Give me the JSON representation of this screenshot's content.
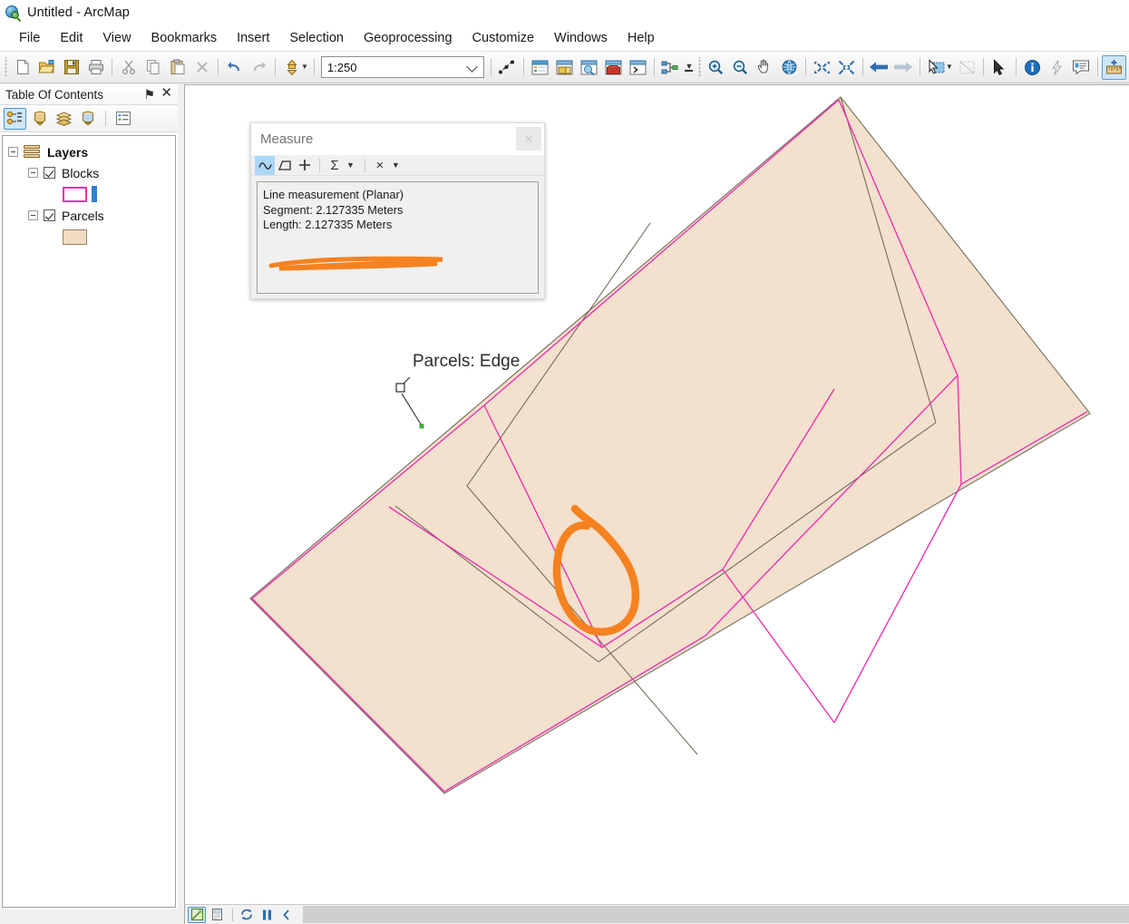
{
  "window": {
    "title": "Untitled - ArcMap",
    "app_icon": "arcmap-globe-icon"
  },
  "menubar": {
    "items": [
      {
        "label": "File",
        "name": "menu-file"
      },
      {
        "label": "Edit",
        "name": "menu-edit"
      },
      {
        "label": "View",
        "name": "menu-view"
      },
      {
        "label": "Bookmarks",
        "name": "menu-bookmarks"
      },
      {
        "label": "Insert",
        "name": "menu-insert"
      },
      {
        "label": "Selection",
        "name": "menu-selection"
      },
      {
        "label": "Geoprocessing",
        "name": "menu-geoprocessing"
      },
      {
        "label": "Customize",
        "name": "menu-customize"
      },
      {
        "label": "Windows",
        "name": "menu-windows"
      },
      {
        "label": "Help",
        "name": "menu-help"
      }
    ]
  },
  "toolbar": {
    "scale_value": "1:250",
    "scale_placeholder": "1:250",
    "buttons": [
      {
        "name": "new-document-icon",
        "tooltip": "New"
      },
      {
        "name": "open-document-icon",
        "tooltip": "Open"
      },
      {
        "name": "save-icon",
        "tooltip": "Save"
      },
      {
        "name": "print-icon",
        "tooltip": "Print"
      },
      {
        "name": "cut-icon",
        "tooltip": "Cut"
      },
      {
        "name": "copy-icon",
        "tooltip": "Copy"
      },
      {
        "name": "paste-icon",
        "tooltip": "Paste"
      },
      {
        "name": "delete-icon",
        "tooltip": "Delete"
      },
      {
        "name": "undo-icon",
        "tooltip": "Undo"
      },
      {
        "name": "redo-icon",
        "tooltip": "Redo"
      },
      {
        "name": "add-data-icon",
        "tooltip": "Add Data"
      },
      {
        "name": "editor-toolbar-icon",
        "tooltip": "Editor"
      },
      {
        "name": "table-of-contents-icon",
        "tooltip": "Table Of Contents"
      },
      {
        "name": "catalog-icon",
        "tooltip": "Catalog"
      },
      {
        "name": "search-window-icon",
        "tooltip": "Search"
      },
      {
        "name": "arctoolbox-icon",
        "tooltip": "ArcToolbox"
      },
      {
        "name": "python-window-icon",
        "tooltip": "Python"
      },
      {
        "name": "model-builder-icon",
        "tooltip": "ModelBuilder"
      },
      {
        "name": "zoom-in-icon",
        "tooltip": "Zoom In"
      },
      {
        "name": "zoom-out-icon",
        "tooltip": "Zoom Out"
      },
      {
        "name": "pan-icon",
        "tooltip": "Pan"
      },
      {
        "name": "full-extent-icon",
        "tooltip": "Full Extent"
      },
      {
        "name": "fixed-zoom-in-icon",
        "tooltip": "Fixed Zoom In"
      },
      {
        "name": "fixed-zoom-out-icon",
        "tooltip": "Fixed Zoom Out"
      },
      {
        "name": "go-back-extent-icon",
        "tooltip": "Go Back To Previous Extent"
      },
      {
        "name": "go-next-extent-icon",
        "tooltip": "Go To Next Extent"
      },
      {
        "name": "select-features-icon",
        "tooltip": "Select Features"
      },
      {
        "name": "clear-selection-icon",
        "tooltip": "Clear Selected Features"
      },
      {
        "name": "select-elements-icon",
        "tooltip": "Select Elements"
      },
      {
        "name": "identify-icon",
        "tooltip": "Identify"
      },
      {
        "name": "hyperlink-icon",
        "tooltip": "Hyperlink"
      },
      {
        "name": "html-popup-icon",
        "tooltip": "HTML Popup"
      },
      {
        "name": "measure-icon",
        "tooltip": "Measure"
      }
    ]
  },
  "toc": {
    "title": "Table Of Contents",
    "pin_glyph": "⚑",
    "close_glyph": "✕",
    "tool_buttons": [
      {
        "name": "list-by-drawing-order-icon",
        "active": true
      },
      {
        "name": "list-by-source-icon",
        "active": false
      },
      {
        "name": "list-by-visibility-icon",
        "active": false
      },
      {
        "name": "list-by-selection-icon",
        "active": false
      },
      {
        "name": "options-icon",
        "active": false
      }
    ],
    "tree": {
      "root_label": "Layers",
      "layers": [
        {
          "label": "Blocks",
          "checked": true,
          "symbol": "hollow-magenta-rectangle-plus-blue-bar"
        },
        {
          "label": "Parcels",
          "checked": true,
          "symbol": "tan-filled-rectangle"
        }
      ]
    }
  },
  "measure_dialog": {
    "title": "Measure",
    "close_glyph": "×",
    "tools": [
      {
        "name": "measure-line-tool",
        "glyph": "∿",
        "active": true
      },
      {
        "name": "measure-area-tool",
        "glyph": "◱",
        "active": false
      },
      {
        "name": "measure-feature-tool",
        "glyph": "+",
        "active": false
      },
      {
        "name": "show-total-tool",
        "glyph": "Σ",
        "active": false
      },
      {
        "name": "show-total-dropdown",
        "glyph": "▼",
        "active": false
      },
      {
        "name": "clear-measurement-tool",
        "glyph": "×",
        "active": false
      },
      {
        "name": "measure-options-dropdown",
        "glyph": "▼",
        "active": false
      }
    ],
    "report": {
      "header": "Line measurement (Planar)",
      "segment": "Segment: 2.127335 Meters",
      "length": "Length: 2.127335 Meters"
    }
  },
  "map": {
    "tooltip_label": "Parcels: Edge",
    "colors": {
      "parcel_fill": "#f3e0cd",
      "parcel_outline": "#6b6250",
      "block_outline": "#ec2fb0",
      "annotation": "#f58220",
      "map_background": "#ffffff"
    },
    "status_bar": {
      "buttons": [
        {
          "name": "data-view-button",
          "active": true
        },
        {
          "name": "layout-view-button",
          "active": false
        },
        {
          "name": "refresh-view-button",
          "active": false
        },
        {
          "name": "pause-drawing-button",
          "active": false
        },
        {
          "name": "toggle-panel-button",
          "active": false
        }
      ]
    }
  },
  "annotations": [
    {
      "name": "orange-underline-annotation",
      "target": "measurement-length-text"
    },
    {
      "name": "orange-circle-annotation",
      "target": "measured-line-on-map"
    }
  ]
}
